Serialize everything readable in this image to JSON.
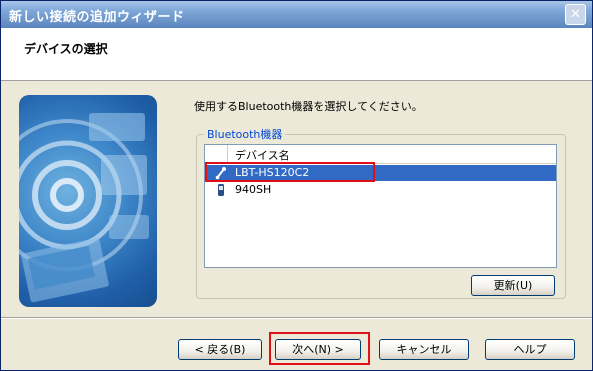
{
  "window": {
    "title": "新しい接続の追加ウィザード",
    "close_glyph": "✕"
  },
  "header": {
    "title": "デバイスの選択"
  },
  "main": {
    "instruction": "使用するBluetooth機器を選択してください。",
    "group_label": "Bluetooth機器",
    "column_header": "デバイス名",
    "devices": [
      {
        "name": "LBT-HS120C2",
        "icon": "headset-icon",
        "selected": true
      },
      {
        "name": "940SH",
        "icon": "phone-icon",
        "selected": false
      }
    ],
    "refresh_label": "更新(U)"
  },
  "buttons": {
    "back": "< 戻る(B)",
    "next": "次へ(N) >",
    "cancel": "キャンセル",
    "help": "ヘルプ"
  },
  "colors": {
    "selection": "#316ac5",
    "highlight": "#e0101b",
    "group_label": "#0046d5"
  }
}
